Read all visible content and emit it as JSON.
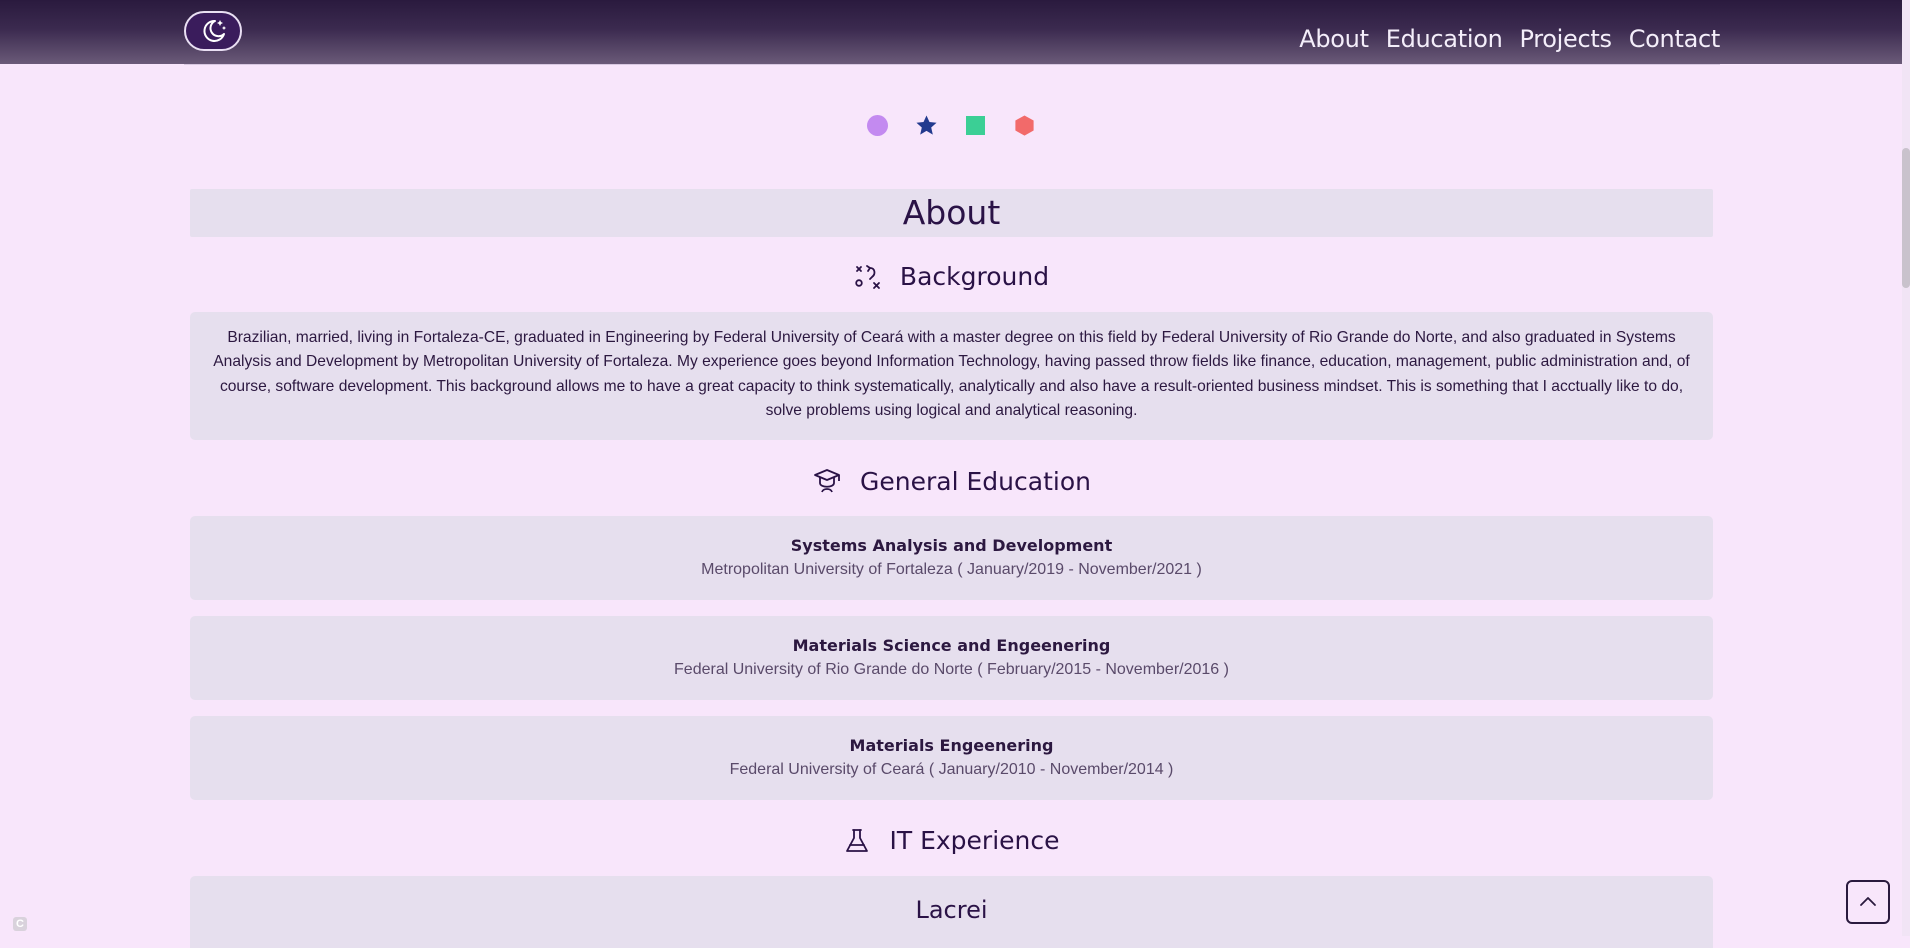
{
  "nav": {
    "items": [
      "About",
      "Education",
      "Projects",
      "Contact"
    ]
  },
  "theme_colors": [
    "#c38af0",
    "#233a8e",
    "#3bcf95",
    "#f26a6a"
  ],
  "about": {
    "title": "About",
    "background": {
      "heading": "Background",
      "icon": "strategy-icon",
      "text": "Brazilian, married, living in Fortaleza-CE, graduated in Engineering by Federal University of Ceará with a master degree on this field by Federal University of Rio Grande do Norte, and also graduated in Systems Analysis and Development by Metropolitan University of Fortaleza. My experience goes beyond Information Technology, having passed throw fields like finance, education, management, public administration and, of course, software development. This background allows me to have a great capacity to think systematically, analytically and also have a result-oriented business mindset. This is something that I acctually like to do, solve problems using logical and analytical reasoning."
    },
    "education": {
      "heading": "General Education",
      "icon": "graduation-cap-icon",
      "items": [
        {
          "course": "Systems Analysis and Development",
          "institution": "Metropolitan University of Fortaleza",
          "period": "( January/2019 - November/2021 )"
        },
        {
          "course": "Materials Science and Engeenering",
          "institution": "Federal University of Rio Grande do Norte",
          "period": "( February/2015 - November/2016 )"
        },
        {
          "course": "Materials Engeenering",
          "institution": "Federal University of Ceará",
          "period": "( January/2010 - November/2014 )"
        }
      ]
    },
    "experience": {
      "heading": "IT Experience",
      "icon": "flask-icon",
      "first_item": "Lacrei"
    }
  },
  "corner_badge": "C"
}
